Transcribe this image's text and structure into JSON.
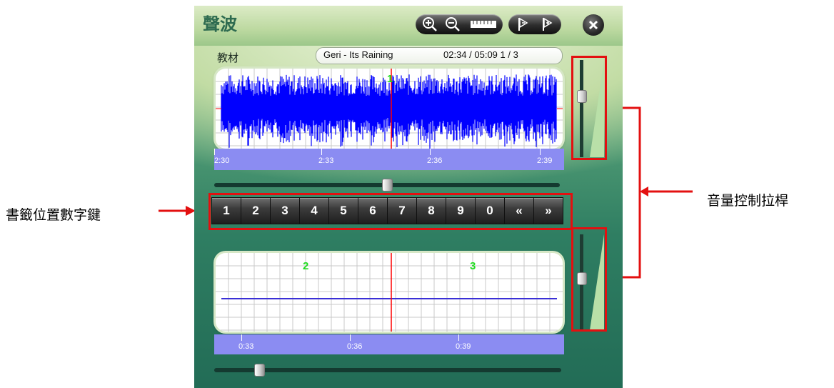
{
  "window": {
    "title": "聲波",
    "toolbar_buttons": [
      {
        "name": "zoom-in-icon"
      },
      {
        "name": "zoom-out-icon"
      },
      {
        "name": "ruler-icon"
      },
      {
        "name": "bookmark-prev-icon"
      },
      {
        "name": "bookmark-add-icon"
      }
    ],
    "close_icon": "close-icon"
  },
  "material_label": "教材",
  "track": {
    "title": "Geri - Its Raining",
    "position": "02:34 / 05:09 1 / 3"
  },
  "top_wave": {
    "bookmark_number": "1",
    "wave_color": "#0000ff",
    "cursor_color": "#ff0000",
    "timeline_labels": [
      "2:30",
      "2:33",
      "2:36",
      "2:39"
    ],
    "scroll_position": 0.5
  },
  "bottom_wave": {
    "bookmark_numbers": [
      "2",
      "3"
    ],
    "line_color": "#3a2fd6",
    "cursor_color": "#ff0000",
    "timeline_labels": [
      "0:33",
      "0:36",
      "0:39"
    ],
    "scroll_position": 0.12
  },
  "bookmark_keys": [
    "1",
    "2",
    "3",
    "4",
    "5",
    "6",
    "7",
    "8",
    "9",
    "0",
    "«",
    "»"
  ],
  "volume": {
    "top_level": 0.65,
    "bottom_level": 0.55
  },
  "annotations": {
    "left": "書籤位置數字鍵",
    "right": "音量控制拉桿"
  },
  "colors": {
    "annotation_red": "#e31010",
    "timeline_bar": "#8b8cf2",
    "bookmark_green": "#22dd22"
  }
}
